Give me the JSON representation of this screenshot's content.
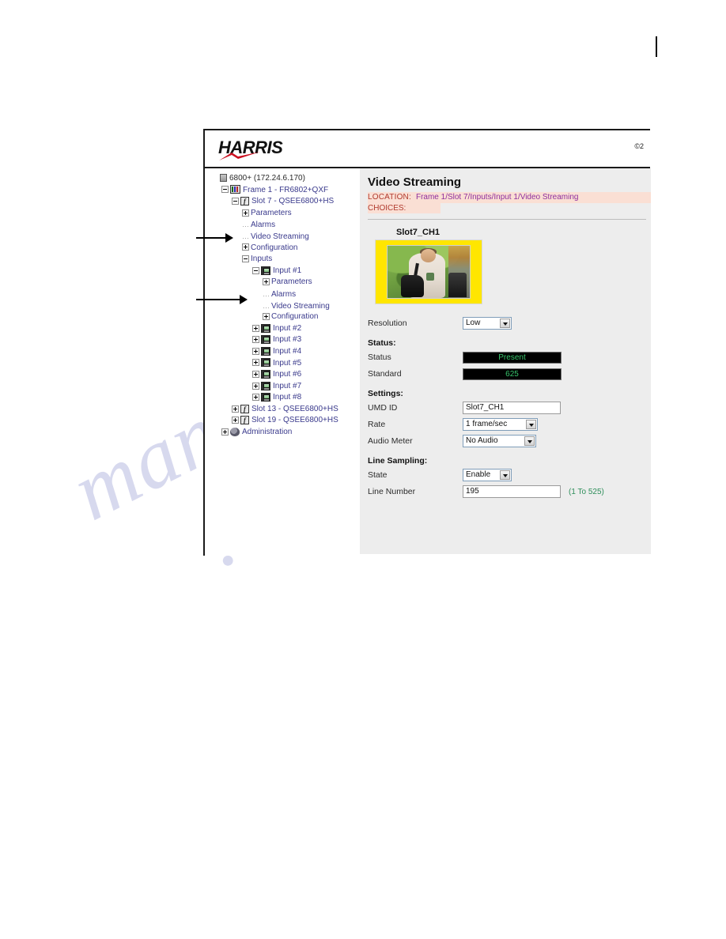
{
  "page": {
    "corner_mark": "|",
    "watermark_line1": "manualslive",
    "watermark_line2": ".com"
  },
  "app": {
    "brand": {
      "logo_text": "HARRIS",
      "logo_icon": "harris-swoosh-logo",
      "copyright": "©2"
    }
  },
  "tree": {
    "nodes": [
      {
        "label": "6800+ (172.24.6.170)",
        "icon": "server-icon",
        "indent": 0,
        "toggle": "none",
        "connector": "none",
        "root": true
      },
      {
        "label": "Frame 1 - FR6802+QXF",
        "icon": "frame-icon",
        "indent": 1,
        "toggle": "minus",
        "connector": "none"
      },
      {
        "label": "Slot 7 - QSEE6800+HS",
        "icon": "slot-icon",
        "indent": 2,
        "toggle": "minus",
        "connector": "none"
      },
      {
        "label": "Parameters",
        "icon": "none",
        "indent": 3,
        "toggle": "plus",
        "connector": "dots"
      },
      {
        "label": "Alarms",
        "icon": "none",
        "indent": 3,
        "toggle": "none",
        "connector": "dots"
      },
      {
        "label": "Video Streaming",
        "icon": "none",
        "indent": 3,
        "toggle": "none",
        "connector": "dots"
      },
      {
        "label": "Configuration",
        "icon": "none",
        "indent": 3,
        "toggle": "plus",
        "connector": "dots"
      },
      {
        "label": "Inputs",
        "icon": "none",
        "indent": 3,
        "toggle": "minus",
        "connector": "dots"
      },
      {
        "label": "Input #1",
        "icon": "monitor-icon",
        "indent": 4,
        "toggle": "minus",
        "connector": "none"
      },
      {
        "label": "Parameters",
        "icon": "none",
        "indent": 5,
        "toggle": "plus",
        "connector": "dots"
      },
      {
        "label": "Alarms",
        "icon": "none",
        "indent": 5,
        "toggle": "none",
        "connector": "dots"
      },
      {
        "label": "Video Streaming",
        "icon": "none",
        "indent": 5,
        "toggle": "none",
        "connector": "dots"
      },
      {
        "label": "Configuration",
        "icon": "none",
        "indent": 5,
        "toggle": "plus",
        "connector": "dots"
      },
      {
        "label": "Input #2",
        "icon": "monitor-icon",
        "indent": 4,
        "toggle": "plus",
        "connector": "none"
      },
      {
        "label": "Input #3",
        "icon": "monitor-icon",
        "indent": 4,
        "toggle": "plus",
        "connector": "none"
      },
      {
        "label": "Input #4",
        "icon": "monitor-icon",
        "indent": 4,
        "toggle": "plus",
        "connector": "none"
      },
      {
        "label": "Input #5",
        "icon": "monitor-icon",
        "indent": 4,
        "toggle": "plus",
        "connector": "none"
      },
      {
        "label": "Input #6",
        "icon": "monitor-icon",
        "indent": 4,
        "toggle": "plus",
        "connector": "none"
      },
      {
        "label": "Input #7",
        "icon": "monitor-icon",
        "indent": 4,
        "toggle": "plus",
        "connector": "none"
      },
      {
        "label": "Input #8",
        "icon": "monitor-icon",
        "indent": 4,
        "toggle": "plus",
        "connector": "none"
      },
      {
        "label": "Slot 13 - QSEE6800+HS",
        "icon": "slot-icon",
        "indent": 2,
        "toggle": "plus",
        "connector": "none"
      },
      {
        "label": "Slot 19 - QSEE6800+HS",
        "icon": "slot-icon",
        "indent": 2,
        "toggle": "plus",
        "connector": "none"
      },
      {
        "label": "Administration",
        "icon": "admin-icon",
        "indent": 1,
        "toggle": "plus",
        "connector": "none"
      }
    ]
  },
  "annotations": {
    "arrow_1_target": "Video Streaming",
    "arrow_2_target": "Video Streaming"
  },
  "content": {
    "title": "Video Streaming",
    "location_label": "LOCATION:",
    "location_path": "Frame 1/Slot 7/Inputs/Input 1/Video Streaming",
    "choices_label": "CHOICES:",
    "thumbnail": {
      "label": "Slot7_CH1",
      "icon": "video-preview-thumbnail"
    },
    "resolution": {
      "label": "Resolution",
      "value": "Low"
    },
    "status_group": {
      "header": "Status:",
      "rows": [
        {
          "label": "Status",
          "value": "Present"
        },
        {
          "label": "Standard",
          "value": "625"
        }
      ]
    },
    "settings_group": {
      "header": "Settings:",
      "umd_id": {
        "label": "UMD ID",
        "value": "Slot7_CH1"
      },
      "rate": {
        "label": "Rate",
        "value": "1 frame/sec"
      },
      "audio_meter": {
        "label": "Audio Meter",
        "value": "No Audio"
      }
    },
    "line_sampling_group": {
      "header": "Line Sampling:",
      "state": {
        "label": "State",
        "value": "Enable"
      },
      "line_number": {
        "label": "Line Number",
        "value": "195",
        "hint": "(1 To 525)"
      }
    }
  },
  "colors": {
    "led_text": "#37c46b",
    "led_bg": "#000000",
    "location_bg": "#fadfd4",
    "location_label": "#b03a2e",
    "location_path": "#8e2f9e",
    "thumb_border": "#ffe600",
    "tree_text": "#3a3a8c",
    "hint_text": "#2f8f5b",
    "panel_bg": "#ededed",
    "brand_red": "#cc1122"
  }
}
